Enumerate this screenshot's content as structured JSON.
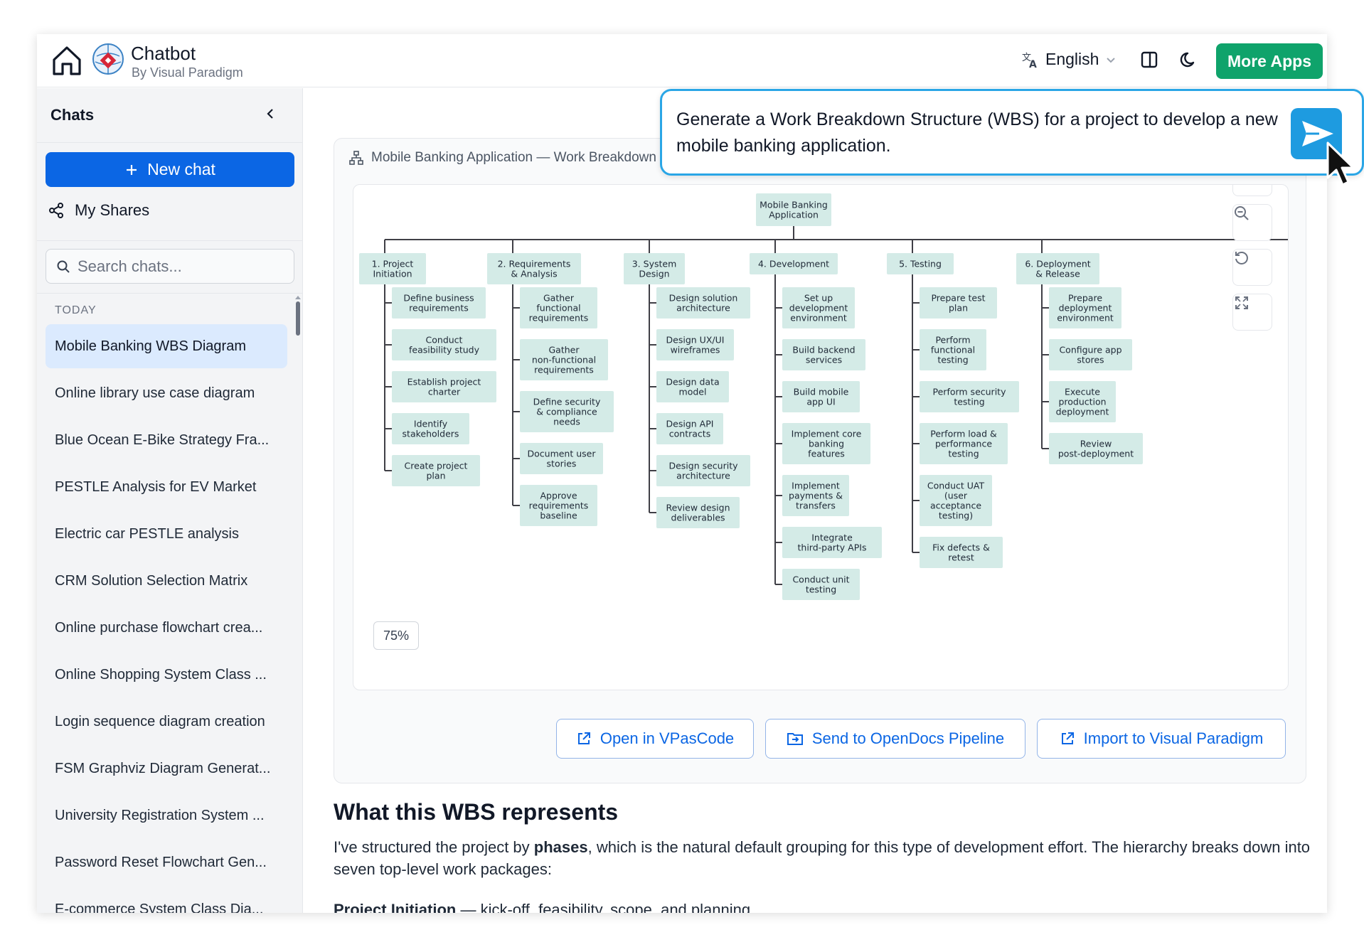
{
  "header": {
    "app_name": "Chatbot",
    "app_subtitle": "By Visual Paradigm",
    "language": "English",
    "more_apps_label": "More Apps",
    "accent_color": "#0fa36b"
  },
  "sidebar": {
    "title": "Chats",
    "new_chat_label": "New chat",
    "my_shares_label": "My Shares",
    "search_placeholder": "Search chats...",
    "section_today": "TODAY",
    "items": [
      {
        "label": "Mobile Banking WBS Diagram",
        "active": true
      },
      {
        "label": "Online library use case diagram"
      },
      {
        "label": "Blue Ocean E-Bike Strategy Fra..."
      },
      {
        "label": "PESTLE Analysis for EV Market"
      },
      {
        "label": "Electric car PESTLE analysis"
      },
      {
        "label": "CRM Solution Selection Matrix"
      },
      {
        "label": "Online purchase flowchart crea..."
      },
      {
        "label": "Online Shopping System Class ..."
      },
      {
        "label": "Login sequence diagram creation"
      },
      {
        "label": "FSM Graphviz Diagram Generat..."
      },
      {
        "label": "University Registration System ..."
      },
      {
        "label": "Password Reset Flowchart Gen..."
      },
      {
        "label": "E-commerce System Class Dia..."
      }
    ]
  },
  "main": {
    "diagram_title": "Mobile Banking Application — Work Breakdown",
    "zoom_level": "75%",
    "actions": {
      "open_vpascode": "Open in VPasCode",
      "send_opendocs": "Send to OpenDocs Pipeline",
      "import_vp": "Import to Visual Paradigm"
    },
    "section_title": "What this WBS represents",
    "section_body_pre": "I've structured the project by ",
    "section_body_bold": "phases",
    "section_body_post": ", which is the natural default grouping for this type of development effort. The hierarchy breaks down into seven top-level work packages:",
    "phase_line_bold": "Project Initiation",
    "phase_line_rest": " — kick-off, feasibility, scope, and planning"
  },
  "wbs": {
    "root": "Mobile Banking\nApplication",
    "phases": [
      {
        "label": "1. Project\nInitiation",
        "children": [
          "Define business\nrequirements",
          "Conduct\nfeasibility study",
          "Establish project\ncharter",
          "Identify\nstakeholders",
          "Create project\nplan"
        ]
      },
      {
        "label": "2. Requirements\n& Analysis",
        "children": [
          "Gather\nfunctional\nrequirements",
          "Gather\nnon-functional\nrequirements",
          "Define security\n& compliance\nneeds",
          "Document user\nstories",
          "Approve\nrequirements\nbaseline"
        ]
      },
      {
        "label": "3. System\nDesign",
        "children": [
          "Design solution\narchitecture",
          "Design UX/UI\nwireframes",
          "Design data\nmodel",
          "Design API\ncontracts",
          "Design security\narchitecture",
          "Review design\ndeliverables"
        ]
      },
      {
        "label": "4. Development",
        "children": [
          "Set up\ndevelopment\nenvironment",
          "Build backend\nservices",
          "Build mobile\napp UI",
          "Implement core\nbanking\nfeatures",
          "Implement\npayments &\ntransfers",
          "Integrate\nthird-party APIs",
          "Conduct unit\ntesting"
        ]
      },
      {
        "label": "5. Testing",
        "children": [
          "Prepare test\nplan",
          "Perform\nfunctional\ntesting",
          "Perform security\ntesting",
          "Perform load &\nperformance\ntesting",
          "Conduct UAT\n(user\nacceptance\ntesting)",
          "Fix defects &\nretest"
        ]
      },
      {
        "label": "6. Deployment\n& Release",
        "children": [
          "Prepare\ndeployment\nenvironment",
          "Configure app\nstores",
          "Execute\nproduction\ndeployment",
          "Review\npost-deployment"
        ]
      }
    ],
    "node_fill": "#d4ebe7",
    "line_color": "#3f3f46"
  },
  "prompt": {
    "text": "Generate a Work Breakdown Structure (WBS) for a project to develop a new mobile banking application.",
    "border_color": "#2aa6e6"
  }
}
